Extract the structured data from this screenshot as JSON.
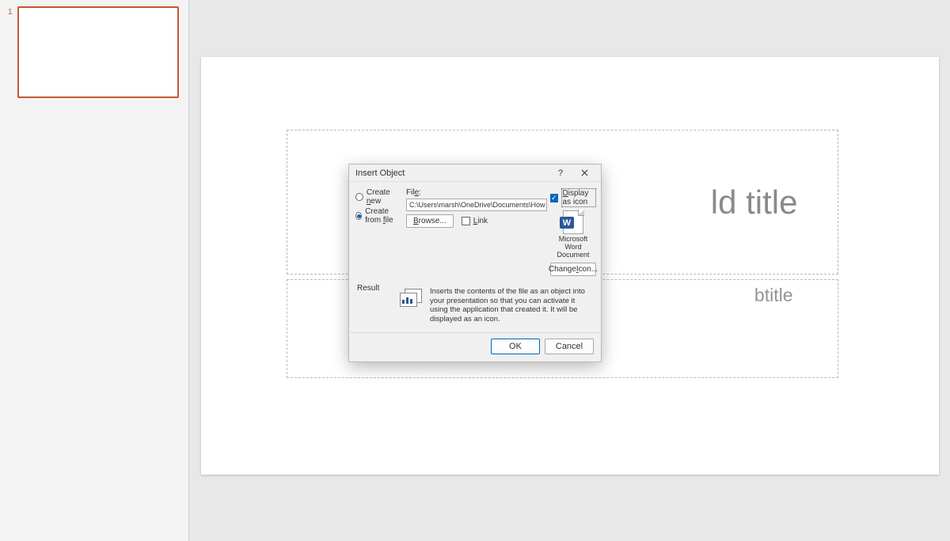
{
  "thumb": {
    "number": "1"
  },
  "slide": {
    "title_placeholder": "ld title",
    "subtitle_placeholder": "btitle"
  },
  "dialog": {
    "title": "Insert Object",
    "help_symbol": "?",
    "radio_create_new": "Create new",
    "radio_create_from_file": "Create from file",
    "file_label": "File:",
    "file_path": "C:\\Users\\marsh\\OneDrive\\Documents\\How to Share Your Mi",
    "browse": "Browse...",
    "link": "Link",
    "display_as_icon": "Display as icon",
    "icon_caption": "Microsoft Word Document",
    "icon_letter": "W",
    "change_icon": "Change Icon...",
    "result_label": "Result",
    "result_text": "Inserts the contents of the file as an object into your presentation so that you can activate it using the application that created it. It will be displayed as an icon.",
    "ok": "OK",
    "cancel": "Cancel",
    "und_new": "n",
    "und_file": "f",
    "und_filelabel": "e",
    "und_browse": "B",
    "und_link": "L",
    "und_display": "D",
    "und_change": "I"
  }
}
